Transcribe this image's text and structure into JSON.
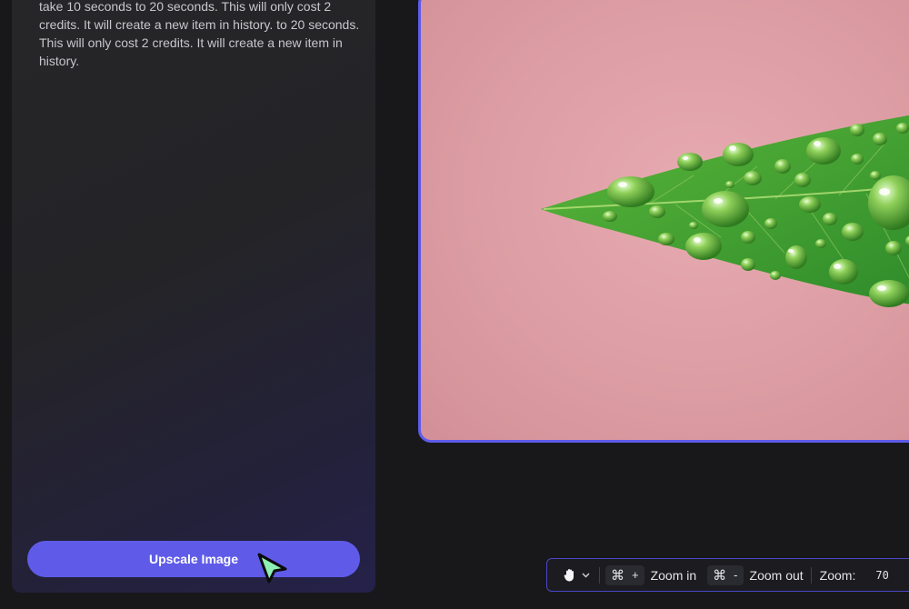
{
  "panel": {
    "description": "take 10 seconds to 20 seconds. This will only cost 2 credits. It will create a new item in history. to 20 seconds. This will only cost 2 credits. It will create a new item in history.",
    "upscale_label": "Upscale Image"
  },
  "toolbar": {
    "hand_tool_icon": "hand-icon",
    "dropdown_icon": "chevron-down-icon",
    "zoom_in_symbol": "⌘",
    "zoom_in_key": "+",
    "zoom_in_label": "Zoom in",
    "zoom_out_symbol": "⌘",
    "zoom_out_key": "-",
    "zoom_out_label": "Zoom out",
    "zoom_label": "Zoom:",
    "zoom_value": "70"
  },
  "colors": {
    "accent": "#5f5be8",
    "background": "#18181b",
    "cursor_fill": "#8ef0b4"
  }
}
